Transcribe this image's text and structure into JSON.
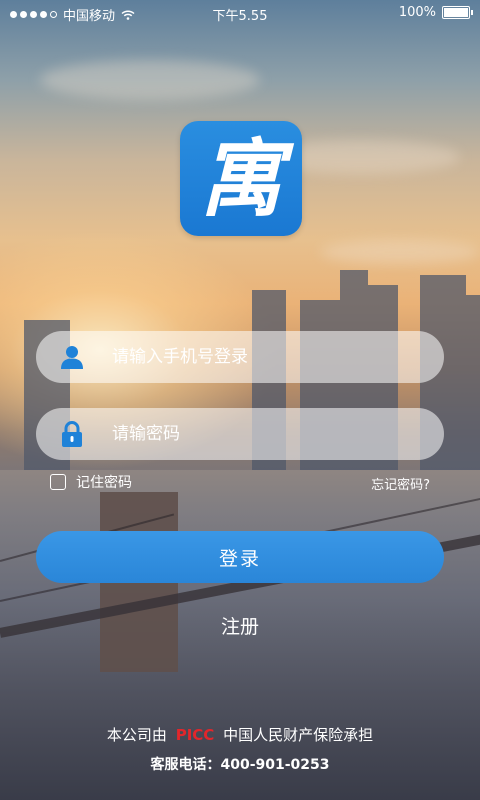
{
  "status_bar": {
    "carrier": "中国移动",
    "time": "下午5.55",
    "battery": "100%"
  },
  "logo": {
    "char": "寓",
    "color": "#1f82d8"
  },
  "login_form": {
    "phone_placeholder": "请输入手机号登录",
    "password_placeholder": "请输密码",
    "remember_label": "记住密码",
    "forgot_label": "忘记密码?",
    "login_button": "登录",
    "register_link": "注册"
  },
  "footer": {
    "line1_prefix": "本公司由",
    "brand": "PICC",
    "line1_suffix": "中国人民财产保险承担",
    "hotline": "客服电话：400-901-0253"
  },
  "colors": {
    "accent": "#2a86d8",
    "brand_red": "#e3262b"
  }
}
